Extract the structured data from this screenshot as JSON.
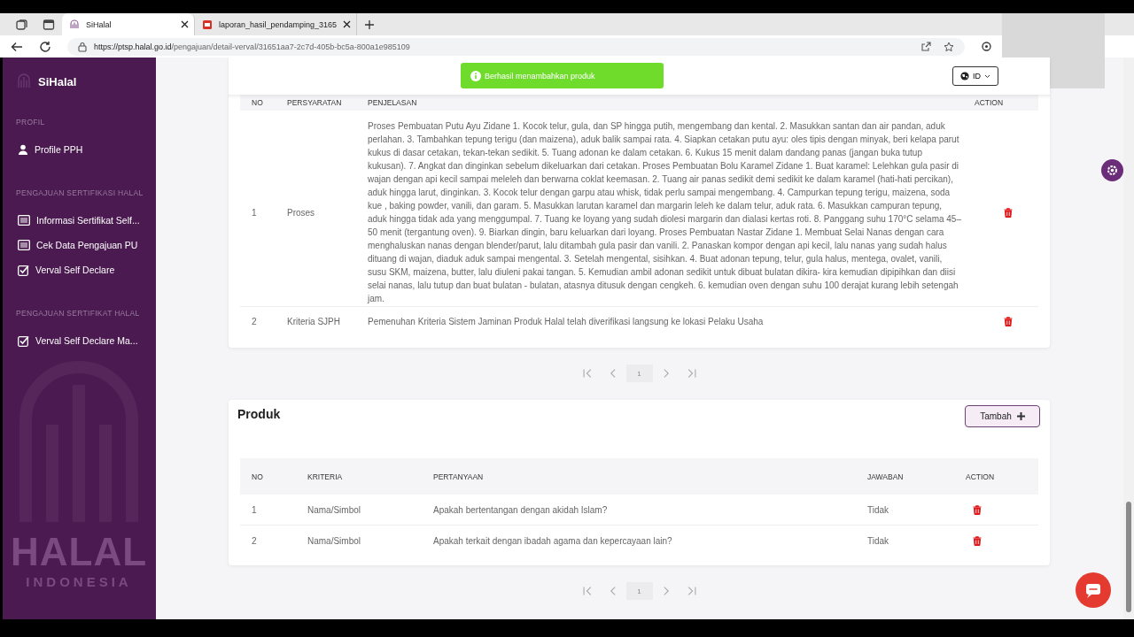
{
  "browser": {
    "tabs": [
      {
        "title": "SiHalal",
        "kind": "site",
        "selected": true
      },
      {
        "title": "laporan_hasil_pendamping_3165",
        "kind": "pdf",
        "selected": false
      }
    ],
    "url_host": "https://ptsp.halal.go.id",
    "url_path": "/pengajuan/detail-verval/31651aa7-2c7d-405b-bc5a-800a1e985109"
  },
  "sidebar": {
    "brand": "SiHalal",
    "watermark": [
      "HALAL",
      "INDONESIA"
    ],
    "sections": [
      {
        "heading": "PROFIL",
        "items": [
          {
            "label": "Profile PPH",
            "kind": "user"
          }
        ]
      },
      {
        "heading": "PENGAJUAN SERTIFIKASI HALAL",
        "items": [
          {
            "label": "Informasi Sertifikat Self...",
            "kind": "list"
          },
          {
            "label": "Cek Data Pengajuan PU",
            "kind": "list"
          },
          {
            "label": "Verval Self Declare",
            "kind": "check"
          }
        ]
      },
      {
        "heading": "PENGAJUAN SERTIFIKAT HALAL",
        "items": [
          {
            "label": "Verval Self Declare Ma...",
            "kind": "check"
          }
        ]
      }
    ]
  },
  "toast": "Berhasil menambahkan produk",
  "language": "ID",
  "requirements": {
    "columns": [
      "NO",
      "PERSYARATAN",
      "PENJELASAN",
      "ACTION"
    ],
    "rows": [
      {
        "no": "1",
        "name": "Proses",
        "detail": "Proses Pembuatan Putu Ayu Zidane 1. Kocok telur, gula, dan SP hingga putih, mengembang dan kental. 2. Masukkan santan dan air pandan, aduk perlahan. 3. Tambahkan tepung terigu (dan maizena), aduk balik sampai rata. 4. Siapkan cetakan putu ayu: oles tipis dengan minyak, beri kelapa parut kukus di dasar cetakan, tekan-tekan sedikit. 5. Tuang adonan ke dalam cetakan. 6. Kukus 15 menit dalam dandang panas (jangan buka tutup kukusan). 7. Angkat dan dinginkan sebelum dikeluarkan dari cetakan. Proses Pembuatan Bolu Karamel Zidane 1. Buat karamel: Lelehkan gula pasir di wajan dengan api kecil sampai meleleh dan berwarna coklat keemasan. 2. Tuang air panas sedikit demi sedikit ke dalam karamel (hati-hati percikan), aduk hingga larut, dinginkan. 3. Kocok telur dengan garpu atau whisk, tidak perlu sampai mengembang. 4. Campurkan tepung terigu, maizena, soda kue , baking powder, vanili, dan garam. 5. Masukkan larutan karamel dan margarin leleh ke dalam telur, aduk rata. 6. Masukkan campuran tepung, aduk hingga tidak ada yang menggumpal. 7. Tuang ke loyang yang sudah diolesi margarin dan dialasi kertas roti. 8. Panggang suhu 170°C selama 45–50 menit (tergantung oven). 9. Biarkan dingin, baru keluarkan dari loyang. Proses Pembuatan Nastar Zidane 1. Membuat Selai Nanas dengan cara menghaluskan nanas dengan blender/parut, lalu ditambah gula pasir dan vanili. 2. Panaskan kompor dengan api kecil, lalu nanas yang sudah halus dituang di wajan, diaduk aduk sampai mengental. 3. Setelah mengental, sisihkan. 4. Buat adonan tepung, telur, gula halus, mentega, ovalet, vanili, susu SKM, maizena, butter, lalu diuleni pakai tangan. 5. Kemudian ambil adonan sedikit untuk dibuat bulatan dikira- kira kemudian dipipihkan dan diisi selai nanas, lalu tutup dan buat bulatan - bulatan, atasnya ditusuk dengan cengkeh. 6. kemudian oven dengan suhu 100 derajat kurang lebih setengah jam."
      },
      {
        "no": "2",
        "name": "Kriteria SJPH",
        "detail": "Pemenuhan Kriteria Sistem Jaminan Produk Halal telah diverifikasi langsung ke lokasi Pelaku Usaha"
      }
    ],
    "page": "1"
  },
  "products": {
    "title": "Produk",
    "add_button": "Tambah",
    "columns": [
      "NO",
      "KRITERIA",
      "PERTANYAAN",
      "JAWABAN",
      "ACTION"
    ],
    "rows": [
      {
        "no": "1",
        "criteria": "Nama/Simbol",
        "question": "Apakah bertentangan dengan akidah Islam?",
        "answer": "Tidak"
      },
      {
        "no": "2",
        "criteria": "Nama/Simbol",
        "question": "Apakah terkait dengan ibadah agama dan kepercayaan lain?",
        "answer": "Tidak"
      }
    ],
    "page": "1"
  }
}
